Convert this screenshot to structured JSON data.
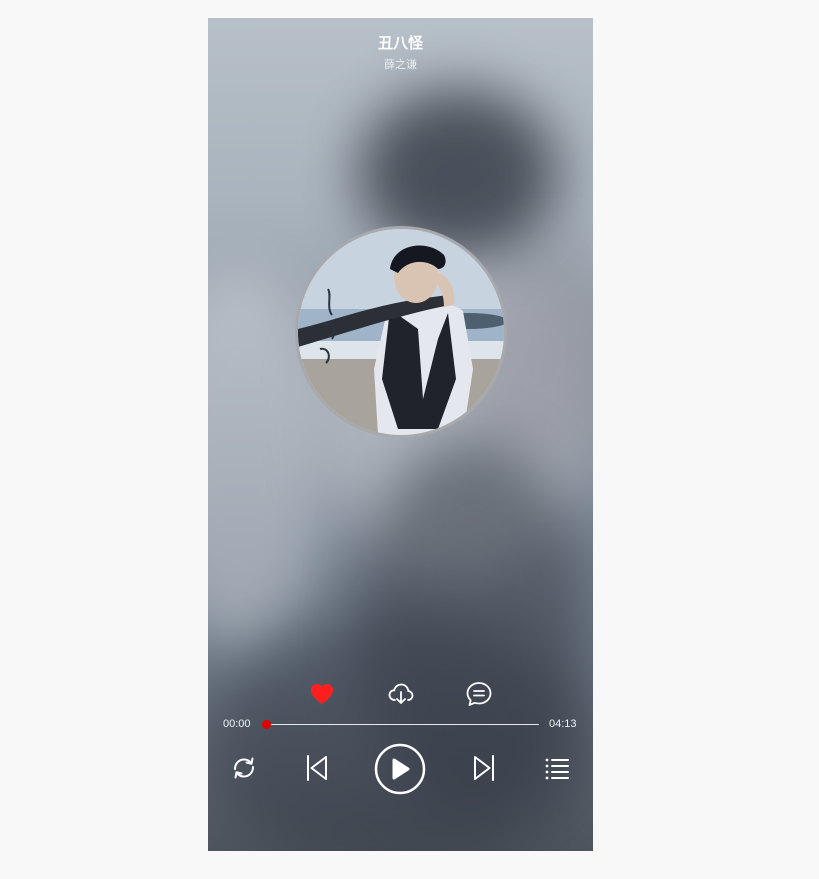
{
  "song": {
    "title": "丑八怪",
    "artist": "薛之谦"
  },
  "progress": {
    "current_time": "00:00",
    "total_time": "04:13",
    "fraction": 0.0
  },
  "actions": {
    "like_icon": "heart-icon",
    "like_color": "#ff1f1f",
    "download_icon": "cloud-download-icon",
    "comment_icon": "comment-icon"
  },
  "controls": {
    "loop_icon": "loop-icon",
    "prev_icon": "previous-icon",
    "play_icon": "play-icon",
    "next_icon": "next-icon",
    "playlist_icon": "playlist-icon"
  },
  "colors": {
    "accent": "#e00000",
    "icon": "#ffffff"
  }
}
